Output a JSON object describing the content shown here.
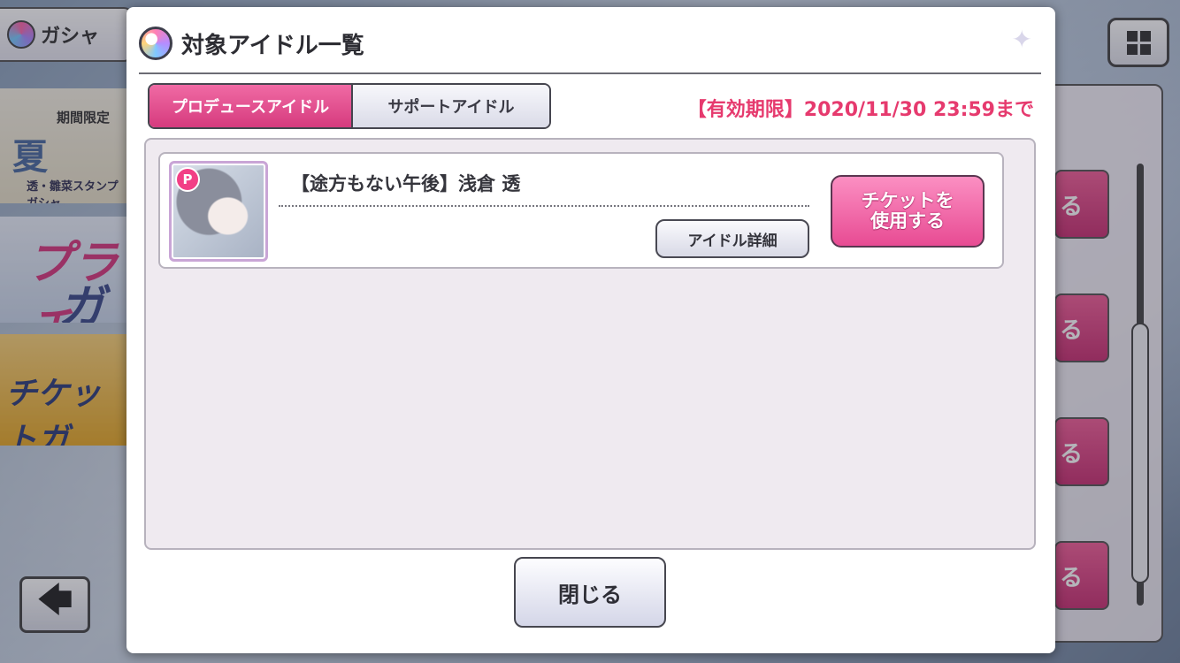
{
  "background": {
    "gacha_tab_label": "ガシャ",
    "banner1_small": "期間限定",
    "banner1_big": "夏",
    "banner1_sub": "透・雛菜スタンプガシャ",
    "banner2_line1": "プラチ",
    "banner2_line2": "ガシ",
    "banner3_label": "チケットガ",
    "right_button_label": "る",
    "back_arrow": "🡄"
  },
  "modal": {
    "title": "対象アイドル一覧",
    "tabs": [
      {
        "label": "プロデュースアイドル",
        "active": true
      },
      {
        "label": "サポートアイドル",
        "active": false
      }
    ],
    "expiry": "【有効期限】2020/11/30 23:59まで",
    "idols": [
      {
        "badge": "P",
        "name": "【途方もない午後】浅倉 透",
        "detail_label": "アイドル詳細",
        "ticket_line1": "チケットを",
        "ticket_line2": "使用する"
      }
    ],
    "close_label": "閉じる"
  },
  "colors": {
    "accent_pink": "#e84b93",
    "expiry_red": "#e63a6e"
  }
}
